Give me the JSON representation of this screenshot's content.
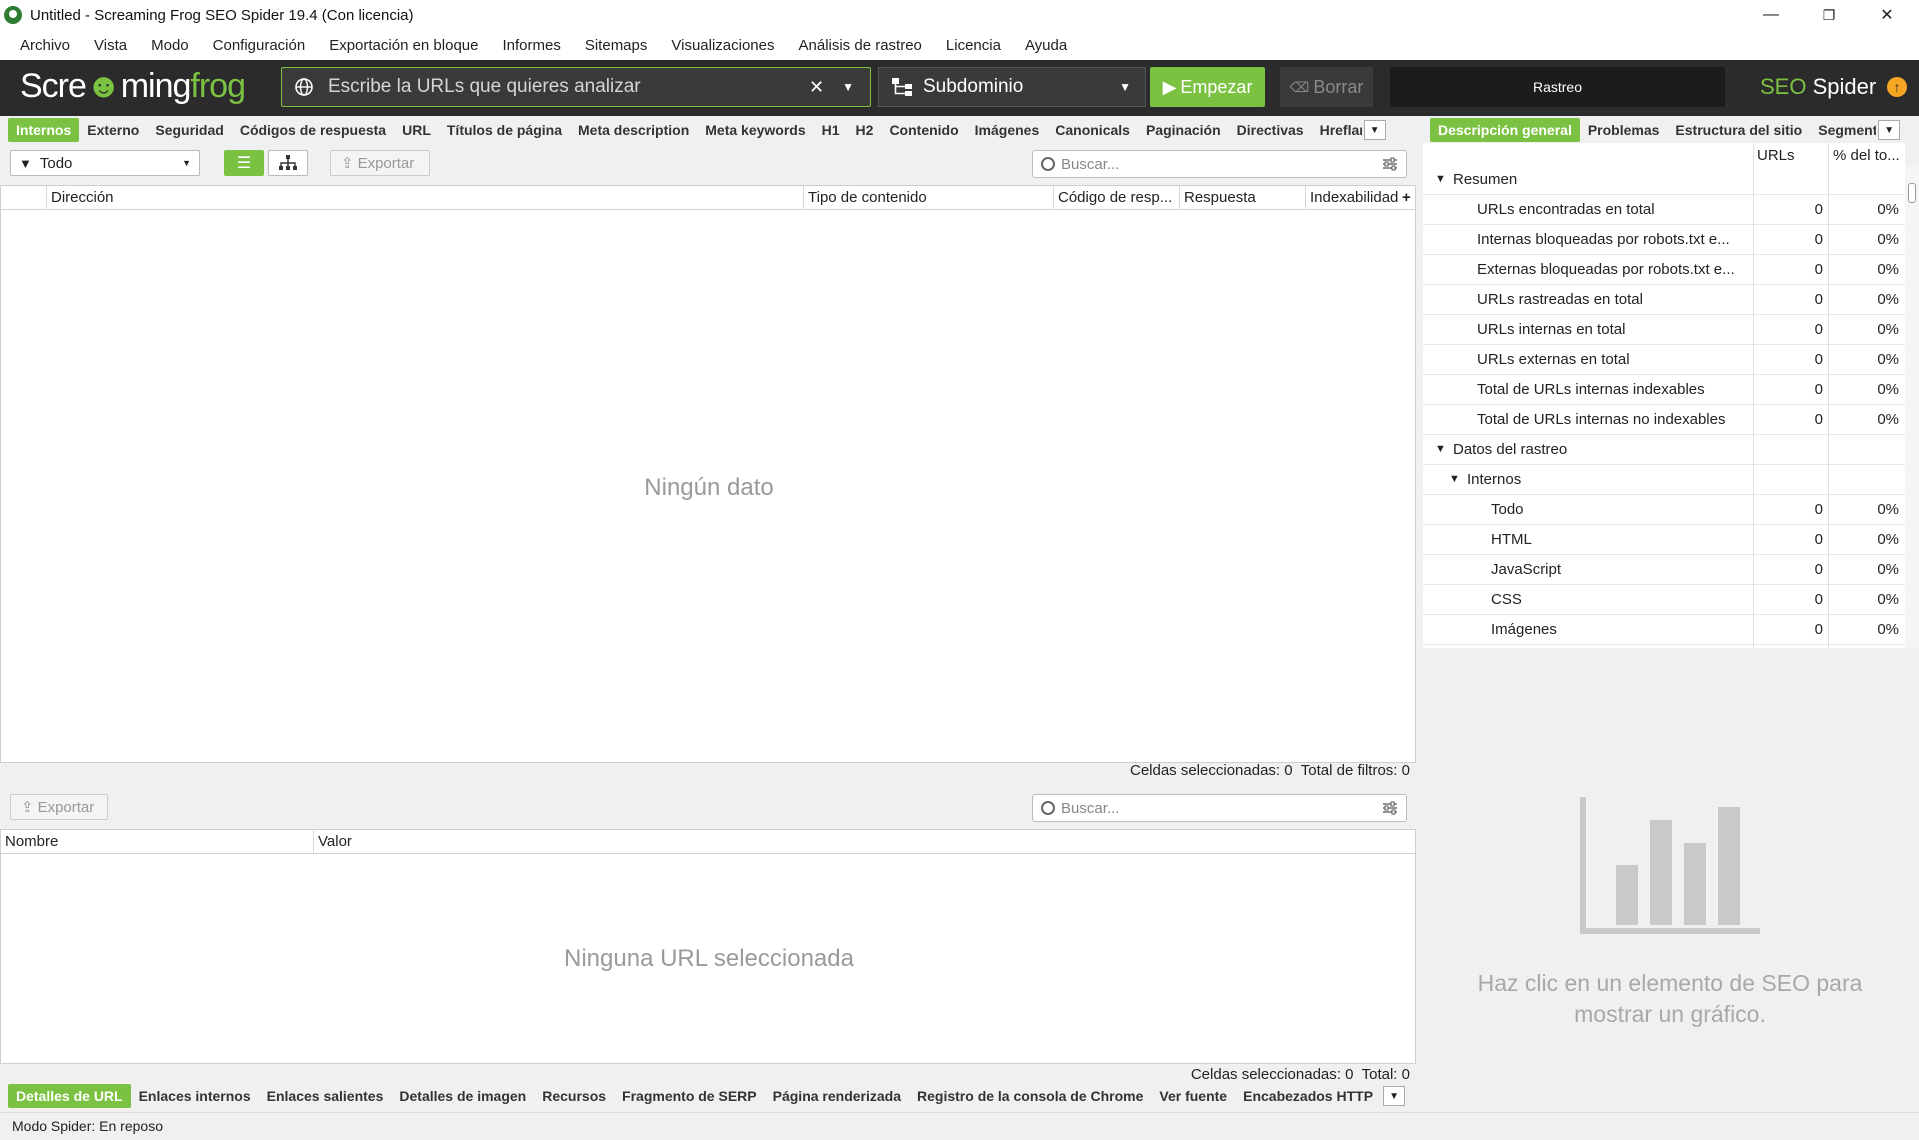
{
  "window": {
    "title": "Untitled - Screaming Frog SEO Spider 19.4 (Con licencia)",
    "minimize": "—",
    "maximize": "❐",
    "close": "✕"
  },
  "menu": [
    "Archivo",
    "Vista",
    "Modo",
    "Configuración",
    "Exportación en bloque",
    "Informes",
    "Sitemaps",
    "Visualizaciones",
    "Análisis de rastreo",
    "Licencia",
    "Ayuda"
  ],
  "toolbar": {
    "logo_a": "Scre",
    "logo_b": "ming",
    "logo_c": "frog",
    "url_placeholder": "Escribe la URLs que quieres analizar",
    "url_clear": "✕",
    "mode": "Subdominio",
    "start": "Empezar",
    "clear": "Borrar",
    "crawl": "Rastreo",
    "brand_seo": "SEO",
    "brand_spider": " Spider",
    "update_badge": "↑",
    "accent": "#7cc242"
  },
  "top_tabs": [
    "Internos",
    "Externo",
    "Seguridad",
    "Códigos de respuesta",
    "URL",
    "Títulos de página",
    "Meta description",
    "Meta keywords",
    "H1",
    "H2",
    "Contenido",
    "Imágenes",
    "Canonicals",
    "Paginación",
    "Directivas",
    "Hreflang"
  ],
  "filter": {
    "value": "Todo",
    "export": "Exportar",
    "search_placeholder": "Buscar..."
  },
  "main_table": {
    "columns": [
      "Dirección",
      "Tipo de contenido",
      "Código de resp...",
      "Respuesta",
      "Indexabilidad"
    ],
    "add_column": "+",
    "empty": "Ningún dato",
    "selected_label": "Celdas seleccionadas:",
    "selected_value": "0",
    "filters_label": "Total de filtros:",
    "filters_value": "0"
  },
  "lower": {
    "export": "Exportar",
    "search_placeholder": "Buscar...",
    "columns": [
      "Nombre",
      "Valor"
    ],
    "empty": "Ninguna URL seleccionada",
    "selected_label": "Celdas seleccionadas:",
    "selected_value": "0",
    "total_label": "Total:",
    "total_value": "0"
  },
  "bottom_tabs": [
    "Detalles de URL",
    "Enlaces internos",
    "Enlaces salientes",
    "Detalles de imagen",
    "Recursos",
    "Fragmento de SERP",
    "Página renderizada",
    "Registro de la consola de Chrome",
    "Ver fuente",
    "Encabezados HTTP"
  ],
  "right_tabs": [
    "Descripción general",
    "Problemas",
    "Estructura del sitio",
    "Segmentos"
  ],
  "overview": {
    "col_urls": "URLs",
    "col_pct": "% del to...",
    "rows": [
      {
        "label": "Resumen",
        "level": 0,
        "group": true
      },
      {
        "label": "URLs encontradas en total",
        "level": 1,
        "urls": "0",
        "pct": "0%"
      },
      {
        "label": "Internas bloqueadas por robots.txt e...",
        "level": 1,
        "urls": "0",
        "pct": "0%"
      },
      {
        "label": "Externas bloqueadas por robots.txt e...",
        "level": 1,
        "urls": "0",
        "pct": "0%"
      },
      {
        "label": "URLs rastreadas en total",
        "level": 1,
        "urls": "0",
        "pct": "0%"
      },
      {
        "label": "URLs internas en total",
        "level": 1,
        "urls": "0",
        "pct": "0%"
      },
      {
        "label": "URLs externas en total",
        "level": 1,
        "urls": "0",
        "pct": "0%"
      },
      {
        "label": "Total de URLs internas indexables",
        "level": 1,
        "urls": "0",
        "pct": "0%"
      },
      {
        "label": "Total de URLs internas no indexables",
        "level": 1,
        "urls": "0",
        "pct": "0%"
      },
      {
        "label": "Datos del rastreo",
        "level": 0,
        "group": true
      },
      {
        "label": "Internos",
        "level": 1,
        "group": true
      },
      {
        "label": "Todo",
        "level": 2,
        "urls": "0",
        "pct": "0%"
      },
      {
        "label": "HTML",
        "level": 2,
        "urls": "0",
        "pct": "0%"
      },
      {
        "label": "JavaScript",
        "level": 2,
        "urls": "0",
        "pct": "0%"
      },
      {
        "label": "CSS",
        "level": 2,
        "urls": "0",
        "pct": "0%"
      },
      {
        "label": "Imágenes",
        "level": 2,
        "urls": "0",
        "pct": "0%"
      }
    ],
    "chart_message": "Haz clic en un elemento de SEO para mostrar un gráfico."
  },
  "status": "Modo Spider: En reposo"
}
